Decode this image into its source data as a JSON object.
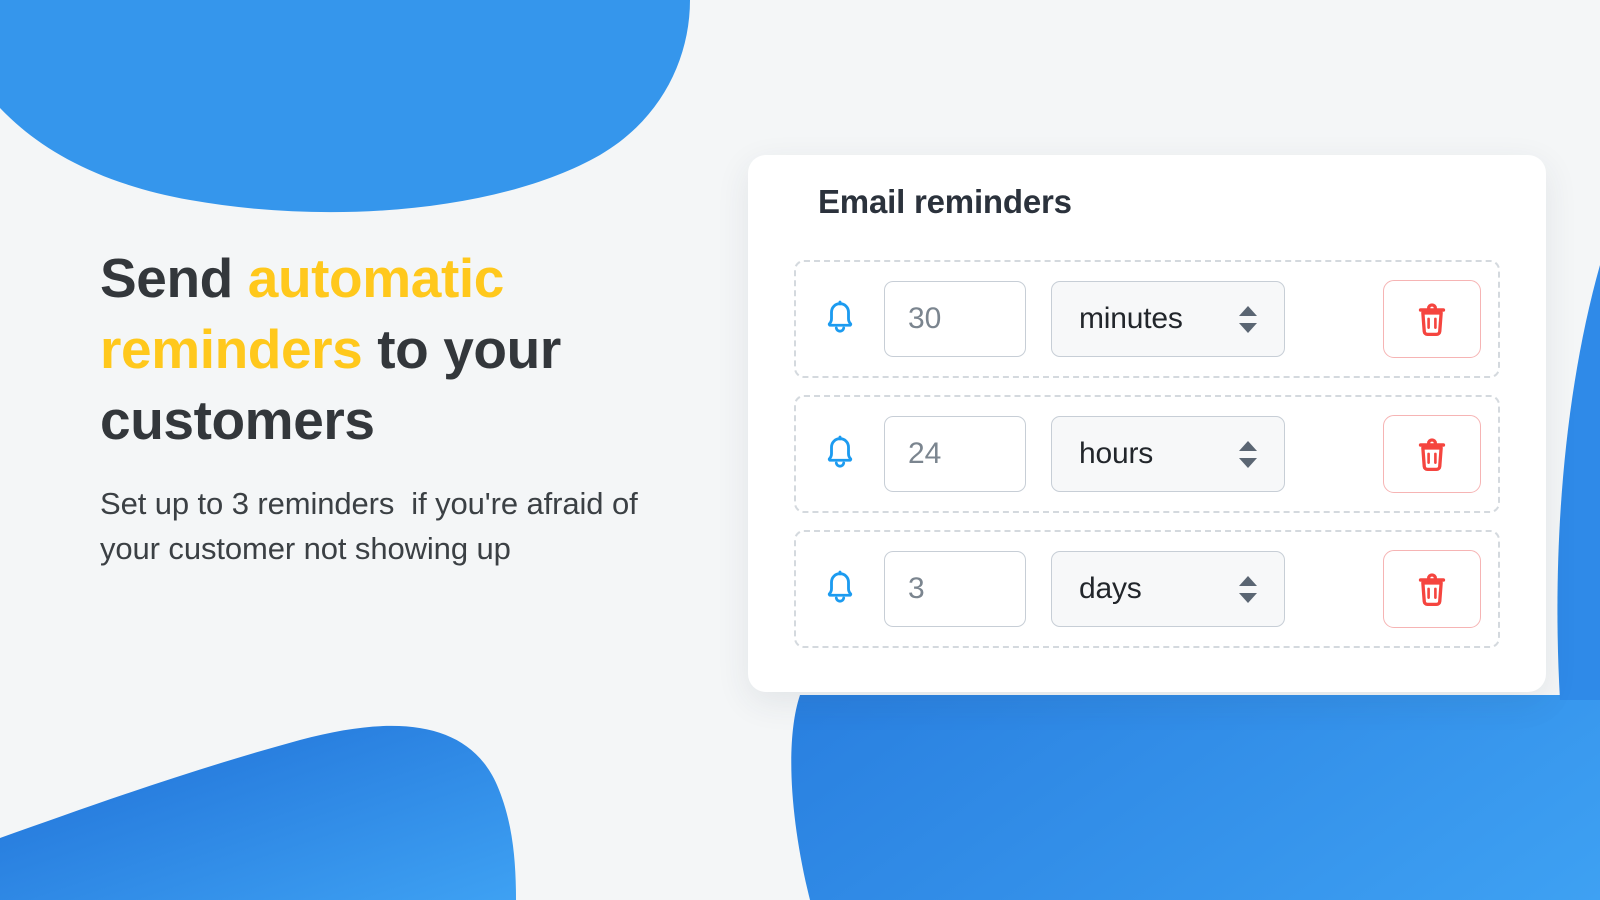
{
  "theme": {
    "background": "#f4f6f7",
    "blue": "#3596ec",
    "blue_dark": "#1f6fd6",
    "yellow": "#ffc81c",
    "heading_color": "#33373b",
    "card_bg": "#ffffff",
    "danger": "#f5453f",
    "danger_border": "#f6b4b4",
    "input_border": "#c7ced6",
    "dashed_border": "#d4d9de",
    "select_bg": "#f7f8f9",
    "value_color": "#7b858f"
  },
  "hero": {
    "headline_parts": [
      {
        "text": "Send ",
        "accent": false
      },
      {
        "text": "automatic reminders",
        "accent": true
      },
      {
        "text": " to your customers",
        "accent": false
      }
    ],
    "headline_plain": "Send automatic reminders to your customers",
    "headline_line1_normal": "Send ",
    "headline_line1_accent": "automatic",
    "headline_line2_accent": "reminders",
    "headline_line2_normal": " to your",
    "headline_line3_normal": "customers",
    "subcopy": "Set up to 3 reminders  if you're afraid of your customer not showing up"
  },
  "card": {
    "title": "Email reminders",
    "reminders": [
      {
        "bell_icon": "bell-icon",
        "value": "30",
        "value_placeholder": "30",
        "unit": "minutes",
        "spinner_icon": "sort-updown-icon",
        "delete_icon": "trash-icon"
      },
      {
        "bell_icon": "bell-icon",
        "value": "24",
        "value_placeholder": "24",
        "unit": "hours",
        "spinner_icon": "sort-updown-icon",
        "delete_icon": "trash-icon"
      },
      {
        "bell_icon": "bell-icon",
        "value": "3",
        "value_placeholder": "3",
        "unit": "days",
        "spinner_icon": "sort-updown-icon",
        "delete_icon": "trash-icon"
      }
    ]
  },
  "decor": {
    "blob_top_left": "blue-blob-top-left",
    "blob_bottom_left": "blue-blob-bottom-left",
    "blob_bottom_right": "blue-blob-bottom-right"
  }
}
